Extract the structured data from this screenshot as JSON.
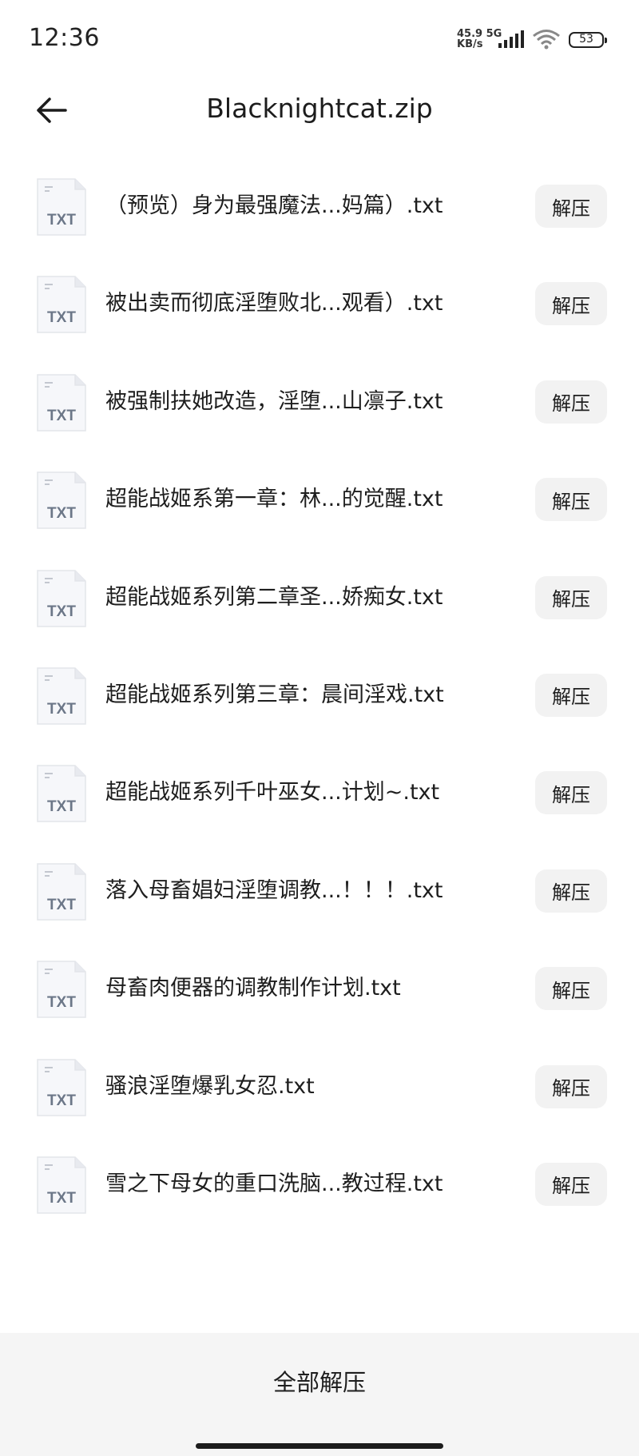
{
  "status_bar": {
    "time": "12:36",
    "net_speed_value": "45.9",
    "net_type": "5G",
    "net_speed_unit": "KB/s",
    "battery": "53"
  },
  "header": {
    "title": "Blacknightcat.zip",
    "back_icon": "arrow-left-icon"
  },
  "file_icon_label": "TXT",
  "files": [
    {
      "name": "（预览）身为最强魔法...妈篇）.txt",
      "action": "解压"
    },
    {
      "name": "被出卖而彻底淫堕败北...观看）.txt",
      "action": "解压"
    },
    {
      "name": "被强制扶她改造，淫堕...山凛子.txt",
      "action": "解压"
    },
    {
      "name": "超能战姬系第一章：林...的觉醒.txt",
      "action": "解压"
    },
    {
      "name": "超能战姬系列第二章圣...娇痴女.txt",
      "action": "解压"
    },
    {
      "name": "超能战姬系列第三章：晨间淫戏.txt",
      "action": "解压"
    },
    {
      "name": "超能战姬系列千叶巫女...计划~.txt",
      "action": "解压"
    },
    {
      "name": "落入母畜娼妇淫堕调教...！！！.txt",
      "action": "解压"
    },
    {
      "name": "母畜肉便器的调教制作计划.txt",
      "action": "解压"
    },
    {
      "name": "骚浪淫堕爆乳女忍.txt",
      "action": "解压"
    },
    {
      "name": "雪之下母女的重口洗脑...教过程.txt",
      "action": "解压"
    }
  ],
  "footer": {
    "extract_all_label": "全部解压"
  }
}
